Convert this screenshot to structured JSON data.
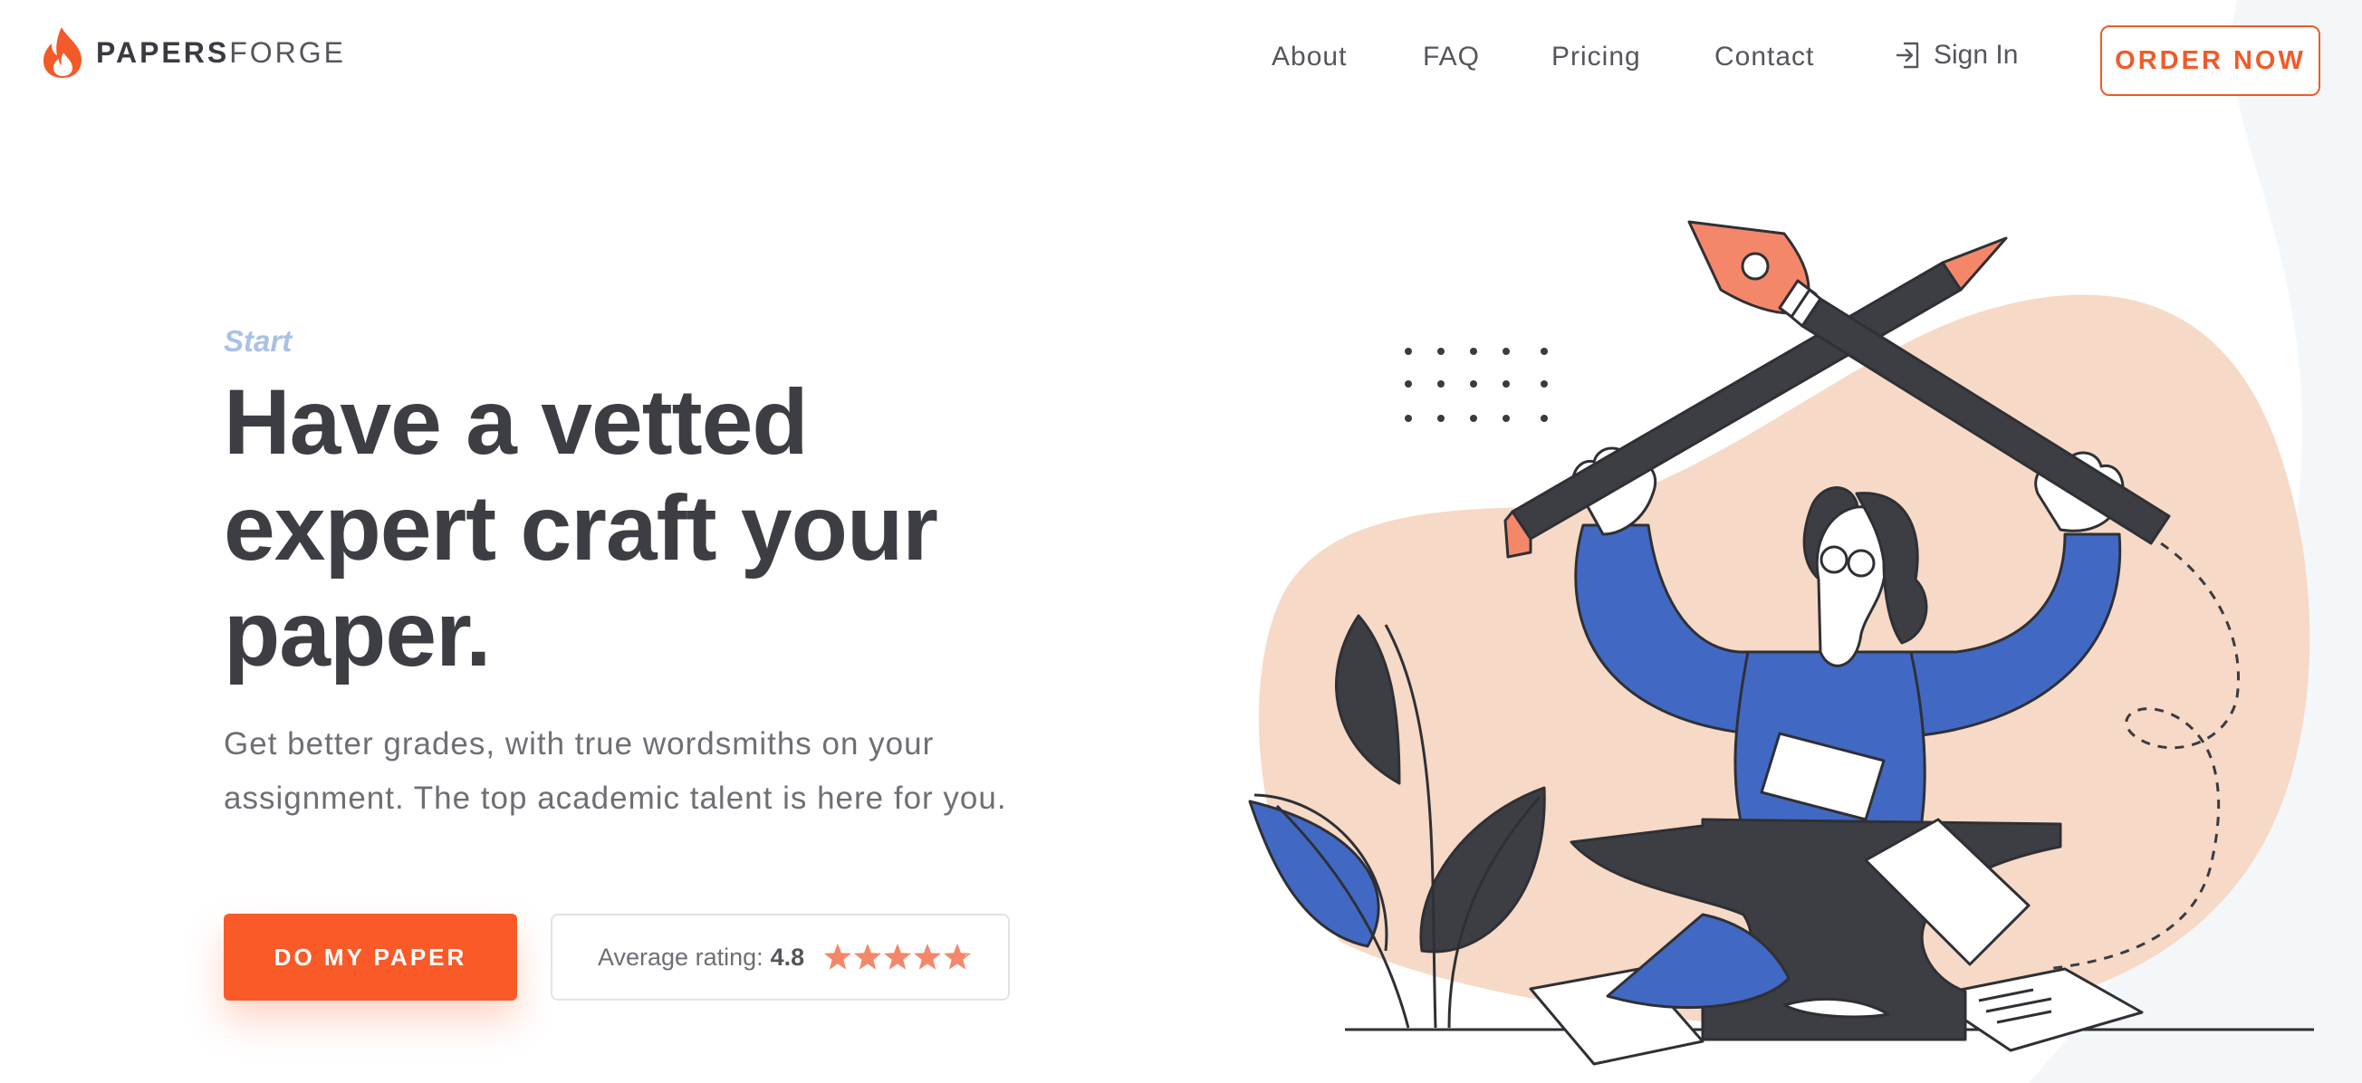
{
  "brand": {
    "name_bold": "PAPERS",
    "name_light": "FORGE",
    "accent": "#f25a29"
  },
  "nav": {
    "items": [
      "About",
      "FAQ",
      "Pricing",
      "Contact"
    ],
    "signin_label": "Sign In",
    "order_label": "ORDER NOW"
  },
  "hero": {
    "eyebrow": "Start",
    "headline": "Have a vetted expert craft your paper.",
    "subtitle": "Get better grades, with true wordsmiths on your assignment. The top academic talent is here for you.",
    "cta_label": "DO MY PAPER",
    "rating_label": "Average rating:",
    "rating_value": "4.8",
    "rating_score": 4.8,
    "rating_max": 5
  },
  "colors": {
    "accent": "#fa5a28",
    "eyebrow": "#a9c1e6",
    "heading": "#3d3e43",
    "body": "#6e6f75",
    "illustration_blob": "#f6d9c6",
    "illustration_blue": "#4169c4",
    "illustration_dark": "#3d3e43"
  },
  "icons": [
    "flame-logo-icon",
    "sign-in-icon",
    "star-icon"
  ]
}
